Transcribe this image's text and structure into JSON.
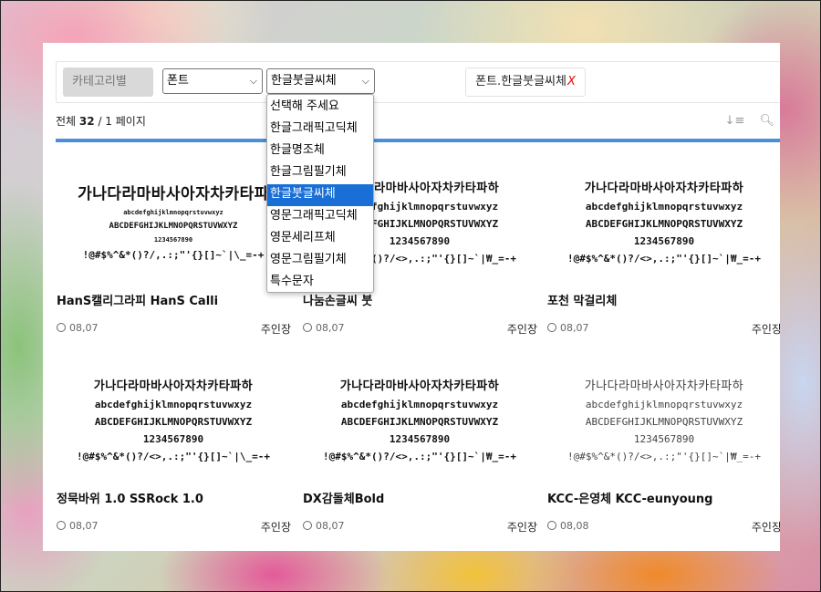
{
  "filter": {
    "category_button": "카테고리별",
    "font_select": "폰트",
    "sub_select": "한글붓글씨체",
    "active_tag": "폰트.한글붓글씨체",
    "tag_remove": "X"
  },
  "summary": {
    "prefix": "전체",
    "total": "32",
    "pages": "/ 1 페이지"
  },
  "dropdown": {
    "options": [
      "선택해 주세요",
      "한글그래픽고딕체",
      "한글명조체",
      "한글그림필기체",
      "한글붓글씨체",
      "영문그래픽고딕체",
      "영문세리프체",
      "영문그림필기체",
      "특수문자"
    ],
    "selected_index": 4
  },
  "cards": [
    {
      "name": "HanS캘리그라피 HanS Calli",
      "date": "08,07",
      "owner": "주인장",
      "preview": [
        "가나다라마바사아자차카타파",
        "abcdefghijklmnopqrstuvwxyz",
        "ABCDEFGHIJKLMNOPQRSTUVWXYZ",
        "1234567890",
        "!@#$%^&*()?/,.:;\"'{}[]~`|\\_=-+"
      ]
    },
    {
      "name": "나눔손글씨 붓",
      "date": "08,07",
      "owner": "주인장",
      "preview": [
        "가나다라마바사아자차카타파하",
        "abcdefghijklmnopqrstuvwxyz",
        "ABCDEFGHIJKLMNOPQRSTUVWXYZ",
        "1234567890",
        "!@#$%^&*()?/<>,.:;\"'{}[]~`|₩_=-+"
      ]
    },
    {
      "name": "포천 막걸리체",
      "date": "08,07",
      "owner": "주인장",
      "preview": [
        "가나다라마바사아자차카타파하",
        "abcdefghijklmnopqrstuvwxyz",
        "ABCDEFGHIJKLMNOPQRSTUVWXYZ",
        "1234567890",
        "!@#$%^&*()?/<>,.:;\"'{}[]~`|₩_=-+"
      ]
    },
    {
      "name": "정묵바위 1.0 SSRock 1.0",
      "date": "08,07",
      "owner": "주인장",
      "preview": [
        "가나다라마바사아자차카타파하",
        "abcdefghijklmnopqrstuvwxyz",
        "ABCDEFGHIJKLMNOPQRSTUVWXYZ",
        "1234567890",
        "!@#$%^&*()?/<>,.:;\"'{}[]~`|\\_=-+"
      ]
    },
    {
      "name": "DX감돌체Bold",
      "date": "08,07",
      "owner": "주인장",
      "preview": [
        "가나다라마바사아자차카타파하",
        "abcdefghijklmnopqrstuvwxyz",
        "ABCDEFGHIJKLMNOPQRSTUVWXYZ",
        "1234567890",
        "!@#$%^&*()?/<>,.:;\"'{}[]~`|₩_=-+"
      ]
    },
    {
      "name": "KCC-은영체 KCC-eunyoung",
      "date": "08,08",
      "owner": "주인장",
      "preview": [
        "가나다라마바사아자차카타파하",
        "abcdefghijklmnopqrstuvwxyz",
        "ABCDEFGHIJKLMNOPQRSTUVWXYZ",
        "1234567890",
        "!@#$%^&*()?/<>,.:;\"'{}[]~`|₩_=-+"
      ]
    }
  ],
  "icons": {
    "sort": "sort-icon",
    "search": "search-icon",
    "clock": "clock-icon",
    "chevron": "chevron-down-icon"
  },
  "colors": {
    "accent": "#4a90d9",
    "selected": "#1a6fd6",
    "remove": "#e00000"
  }
}
